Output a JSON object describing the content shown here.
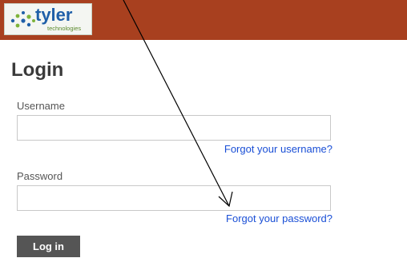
{
  "header": {
    "brand": "tyler",
    "brand_sub": "technologies",
    "bar_color": "#a8401f"
  },
  "login": {
    "title": "Login",
    "username_label": "Username",
    "username_value": "",
    "forgot_username": "Forgot your username?",
    "password_label": "Password",
    "password_value": "",
    "forgot_password": "Forgot your password?",
    "login_button": "Log in"
  }
}
